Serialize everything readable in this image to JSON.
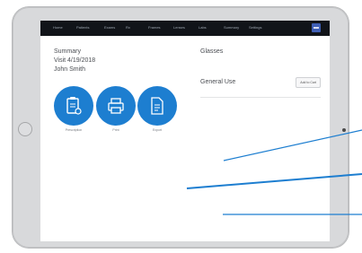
{
  "nav": {
    "items": [
      "Home",
      "Patients",
      "Exams",
      "Rx",
      "Frames",
      "Lenses",
      "Labs",
      "Summary",
      "Settings"
    ],
    "logo_icon": "app-logo-icon"
  },
  "summary": {
    "title": "Summary",
    "visit": "Visit 4/19/2018",
    "patient": "John Smith"
  },
  "actions": [
    {
      "label": "Prescription",
      "icon": "prescription-clipboard-icon"
    },
    {
      "label": "Print",
      "icon": "print-icon"
    },
    {
      "label": "Export",
      "icon": "export-document-icon"
    }
  ],
  "glasses": {
    "title": "Glasses",
    "general_use": "General Use",
    "add_to_cart": "Add to Cart"
  },
  "colors": {
    "accent": "#1d7ed0",
    "nav_bg": "#111419",
    "callout": "#1d7ed0"
  }
}
